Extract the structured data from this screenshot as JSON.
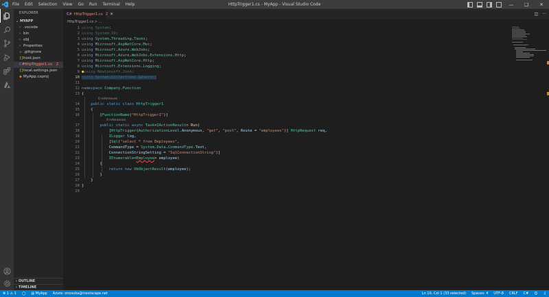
{
  "window": {
    "title": "HttpTrigger1.cs - MyApp - Visual Studio Code",
    "menu": [
      "File",
      "Edit",
      "Selection",
      "View",
      "Go",
      "Run",
      "Terminal",
      "Help"
    ]
  },
  "sidebar": {
    "title": "EXPLORER",
    "root": "MYAPP",
    "items": [
      {
        "label": ".vscode",
        "type": "folder"
      },
      {
        "label": "bin",
        "type": "folder"
      },
      {
        "label": "obj",
        "type": "folder"
      },
      {
        "label": "Properties",
        "type": "folder"
      },
      {
        "label": ".gitignore",
        "type": "file"
      },
      {
        "label": "host.json",
        "type": "file"
      },
      {
        "label": "HttpTrigger1.cs",
        "type": "file",
        "badge": "2"
      },
      {
        "label": "local.settings.json",
        "type": "file"
      },
      {
        "label": "MyApp.csproj",
        "type": "file"
      }
    ],
    "outline": "OUTLINE",
    "timeline": "TIMELINE"
  },
  "tab": {
    "label": "HttpTrigger1.cs",
    "count": "2"
  },
  "breadcrumb": "HttpTrigger1.cs > ...",
  "editor": {
    "codelens_1": "0 references",
    "codelens_2": "0 references"
  },
  "statusbar": {
    "problems": "⊗ 1 ⚠ 1",
    "project": "MyApp",
    "azure": "Azure: onosuka@inestscape.net",
    "position": "Ln 10, Col 1 (33 selected)",
    "spaces": "Spaces: 4",
    "encoding": "UTF-8",
    "eol": "CRLF",
    "language": "C#"
  },
  "colors": {
    "statusbar": "#007acc",
    "activitybar": "#333333",
    "sidebar": "#252526",
    "editor": "#1e1e1e",
    "error": "#f48771",
    "keyword": "#569cd6",
    "type": "#4ec9b0",
    "string": "#ce9178"
  }
}
